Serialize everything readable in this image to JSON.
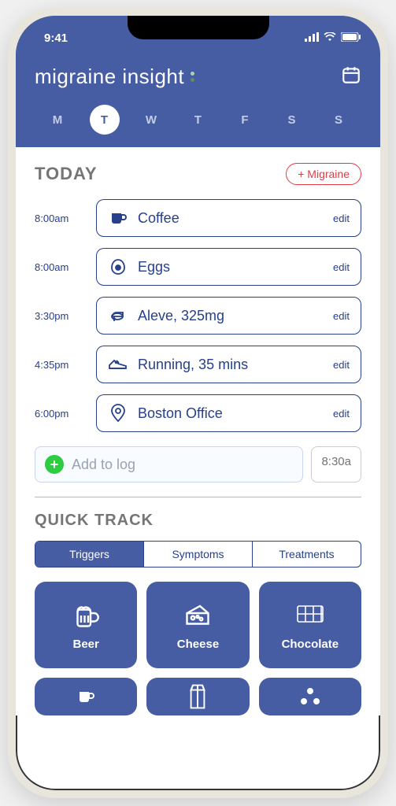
{
  "status": {
    "time": "9:41"
  },
  "app": {
    "title": "migraine insight"
  },
  "days": [
    {
      "label": "M",
      "active": false
    },
    {
      "label": "T",
      "active": true
    },
    {
      "label": "W",
      "active": false
    },
    {
      "label": "T",
      "active": false
    },
    {
      "label": "F",
      "active": false
    },
    {
      "label": "S",
      "active": false
    },
    {
      "label": "S",
      "active": false
    }
  ],
  "today": {
    "title": "TODAY",
    "migraine_btn": "+ Migraine",
    "entries": [
      {
        "time": "8:00am",
        "icon": "mug-icon",
        "label": "Coffee",
        "edit": "edit"
      },
      {
        "time": "8:00am",
        "icon": "egg-icon",
        "label": "Eggs",
        "edit": "edit"
      },
      {
        "time": "3:30pm",
        "icon": "pill-icon",
        "label": "Aleve, 325mg",
        "edit": "edit"
      },
      {
        "time": "4:35pm",
        "icon": "shoe-icon",
        "label": "Running, 35 mins",
        "edit": "edit"
      },
      {
        "time": "6:00pm",
        "icon": "location-icon",
        "label": "Boston Office",
        "edit": "edit"
      }
    ],
    "add_placeholder": "Add to log",
    "add_time": "8:30a"
  },
  "quick": {
    "title": "QUICK TRACK",
    "tabs": [
      {
        "label": "Triggers",
        "active": true
      },
      {
        "label": "Symptoms",
        "active": false
      },
      {
        "label": "Treatments",
        "active": false
      }
    ],
    "tiles": [
      {
        "label": "Beer",
        "icon": "beer-icon"
      },
      {
        "label": "Cheese",
        "icon": "cheese-icon"
      },
      {
        "label": "Chocolate",
        "icon": "chocolate-icon"
      },
      {
        "label": "",
        "icon": "mug-icon"
      },
      {
        "label": "",
        "icon": "milk-icon"
      },
      {
        "label": "",
        "icon": "dots-icon"
      }
    ]
  }
}
